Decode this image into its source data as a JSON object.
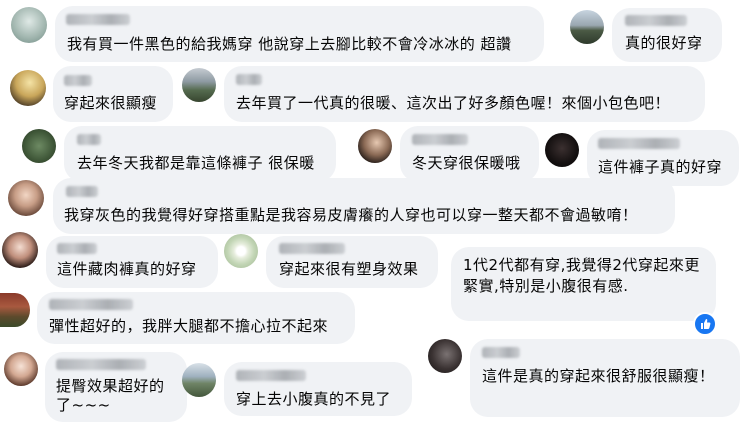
{
  "comments": [
    {
      "text": "我有買一件黑色的給我媽穿 他說穿上去腳比較不會冷冰冰的 超讚"
    },
    {
      "text": "真的很好穿"
    },
    {
      "text": "穿起來很顯瘦"
    },
    {
      "text": "去年買了一代真的很暖、這次出了好多顏色喔！來個小包色吧！"
    },
    {
      "text": "去年冬天我都是靠這條褲子 很保暖"
    },
    {
      "text": "冬天穿很保暖哦"
    },
    {
      "text": "這件褲子真的好穿"
    },
    {
      "text": "我穿灰色的我覺得好穿搭重點是我容易皮膚癢的人穿也可以穿一整天都不會過敏唷！"
    },
    {
      "text": "這件藏肉褲真的好穿"
    },
    {
      "text": "穿起來很有塑身效果"
    },
    {
      "text": "1代2代都有穿,我覺得2代穿起來更緊實,特別是小腹很有感."
    },
    {
      "text": "彈性超好的，我胖大腿都不擔心拉不起來"
    },
    {
      "text": "提臀效果超好的了~~~"
    },
    {
      "text": "穿上去小腹真的不見了"
    },
    {
      "text": "這件是真的穿起來很舒服很顯瘦！"
    }
  ],
  "reaction": {
    "icon": "like-icon"
  }
}
